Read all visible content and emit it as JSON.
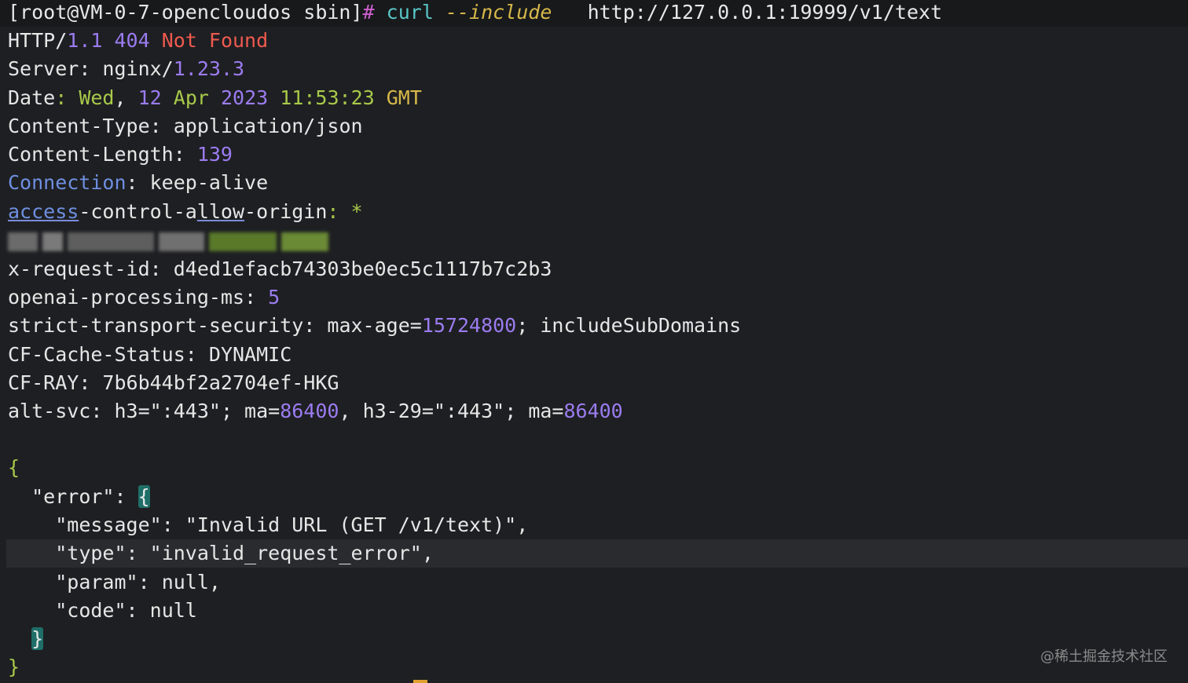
{
  "prompt": {
    "user_host": "[root@VM-0-7-opencloudos sbin]",
    "symbol": "#",
    "command": "curl",
    "flag": "--include",
    "url": "http://127.0.0.1:19999/v1/text"
  },
  "status": {
    "proto": "HTTP/",
    "version": "1.1",
    "code": "404",
    "text": "Not Found"
  },
  "headers": {
    "server_key": "Server",
    "server_name": "nginx/",
    "server_ver": "1.23.3",
    "date_key": "Date",
    "date_day": "Wed",
    "date_num": "12",
    "date_month": "Apr",
    "date_year": "2023",
    "date_time": "11:53:23",
    "date_tz": "GMT",
    "ctype_key": "Content-Type",
    "ctype_val": "application/json",
    "clen_key": "Content-Length",
    "clen_val": "139",
    "conn_key": "Connection",
    "conn_val": "keep-alive",
    "acao_key_1": "access",
    "acao_key_2": "-control-a",
    "acao_key_3": "llow",
    "acao_key_4": "-origin",
    "acao_val": "*",
    "reqid_key": "x-request-id",
    "reqid_val": "d4ed1efacb74303be0ec5c1117b7c2b3",
    "proc_key": "openai-processing-ms",
    "proc_val": "5",
    "sts_key": "strict-transport-security",
    "sts_maxage": "max-age=",
    "sts_num": "15724800",
    "sts_tail": "includeSubDomains",
    "cfcache_key": "CF-Cache-Status",
    "cfcache_val": "DYNAMIC",
    "cfray_key": "CF-RAY",
    "cfray_val": "7b6b44bf2a2704ef-HKG",
    "altsvc_key": "alt-svc",
    "altsvc_h3": "h3=\":443\"",
    "altsvc_ma1": "ma=",
    "altsvc_num1": "86400",
    "altsvc_h329": "h3-29=\":443\"",
    "altsvc_ma2": "ma=",
    "altsvc_num2": "86400"
  },
  "body": {
    "open": "{",
    "error_key": "\"error\"",
    "error_open": "{",
    "message_key": "\"message\"",
    "message_val": "\"Invalid URL (GET /v1/text)\"",
    "type_key": "\"type\"",
    "type_val": "\"invalid_request_error\"",
    "param_key": "\"param\"",
    "param_val": "null",
    "code_key": "\"code\"",
    "code_val": "null",
    "error_close": "}",
    "close": "}"
  },
  "watermark": "@稀土掘金技术社区",
  "colors": {
    "background": "#1e1f22",
    "purple": "#9b7cf0",
    "red": "#ef5a4f",
    "green": "#a8c94a",
    "yellow": "#d6b84a",
    "blue": "#6e8fe0"
  }
}
